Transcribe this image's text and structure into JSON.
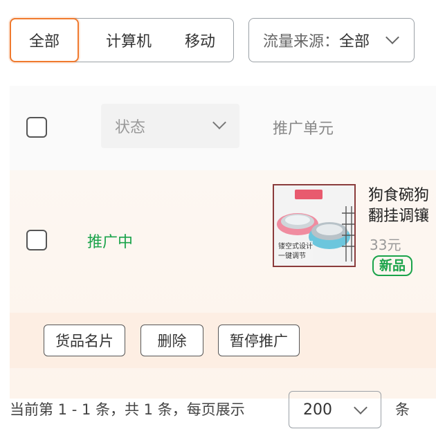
{
  "filters": {
    "device_tabs": [
      "全部",
      "计算机",
      "移动"
    ],
    "active_tab": "全部",
    "source_label": "流量来源：",
    "source_value": "全部"
  },
  "table": {
    "status_placeholder": "状态",
    "unit_header": "推广单元",
    "row": {
      "status": "推广中",
      "product_name": "狗食碗狗翻挂调镶",
      "product_name_line1": "狗食碗狗",
      "product_name_line2": "翻挂调镶",
      "price": "33元",
      "badge": "新品",
      "thumb_caption_1": "镂空式设计",
      "thumb_caption_2": "一键调节"
    },
    "actions": [
      "货品名片",
      "删除",
      "暂停推广"
    ]
  },
  "pagination": {
    "info": "当前第 1 - 1 条，共 1 条，每页展示",
    "page_size": "200",
    "unit": "条"
  },
  "colors": {
    "accent": "#f07a2e",
    "success": "#1aa34a",
    "row_bg": "#fdf4ec"
  }
}
